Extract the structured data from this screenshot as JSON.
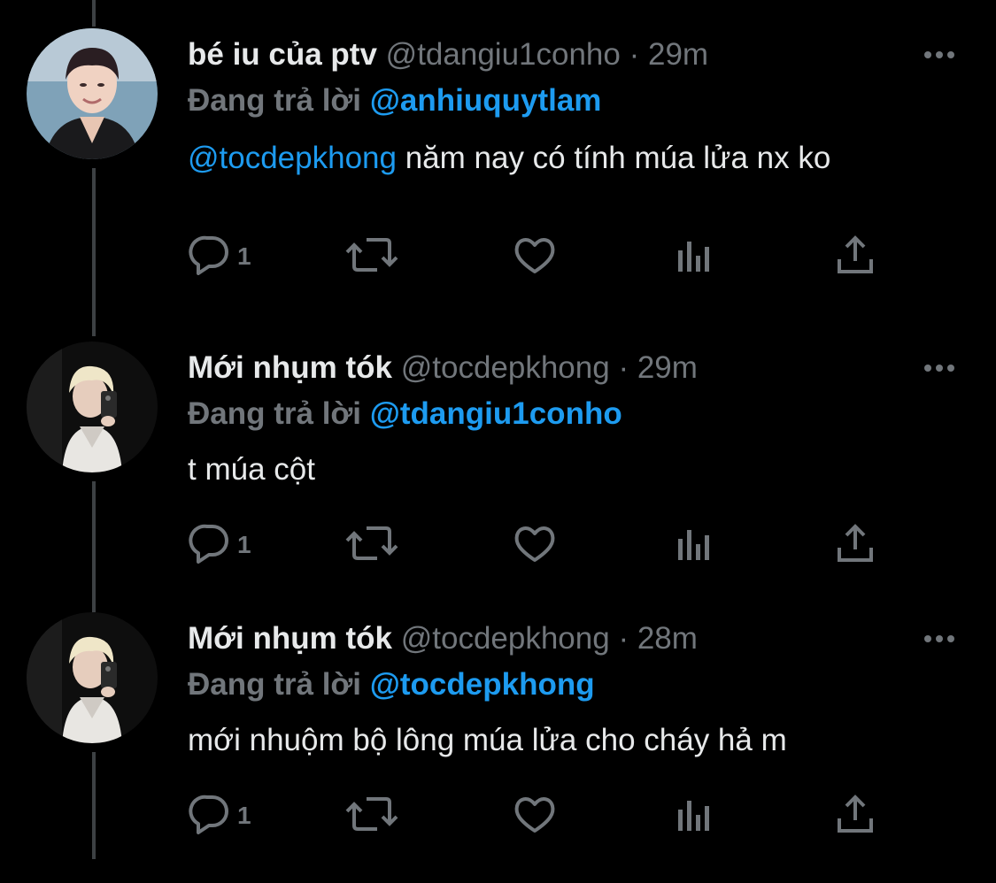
{
  "colors": {
    "background": "#000000",
    "text": "#e7e9ea",
    "muted": "#71767b",
    "accent": "#1d9bf0",
    "thread_line": "#3d4144"
  },
  "tweets": [
    {
      "name": "bé iu của ptv",
      "handle": "@tdangiu1conho",
      "separator": "·",
      "time": "29m",
      "replying_label": "Đang trả lời",
      "replying_to": "@anhiuquytlam",
      "mention": "@tocdepkhong",
      "text": "năm nay có tính múa lửa nx ko",
      "reply_count": "1",
      "icons": {
        "more": "more-icon",
        "reply": "reply-icon",
        "retweet": "retweet-icon",
        "like": "like-icon",
        "views": "views-icon",
        "share": "share-icon"
      }
    },
    {
      "name": "Mới nhụm tók",
      "handle": "@tocdepkhong",
      "separator": "·",
      "time": "29m",
      "replying_label": "Đang trả lời",
      "replying_to": "@tdangiu1conho",
      "mention": "",
      "text": "t múa cột",
      "reply_count": "1"
    },
    {
      "name": "Mới nhụm tók",
      "handle": "@tocdepkhong",
      "separator": "·",
      "time": "28m",
      "replying_label": "Đang trả lời",
      "replying_to": "@tocdepkhong",
      "mention": "",
      "text": "mới nhuộm bộ lông múa lửa cho cháy hả m",
      "reply_count": "1"
    }
  ]
}
